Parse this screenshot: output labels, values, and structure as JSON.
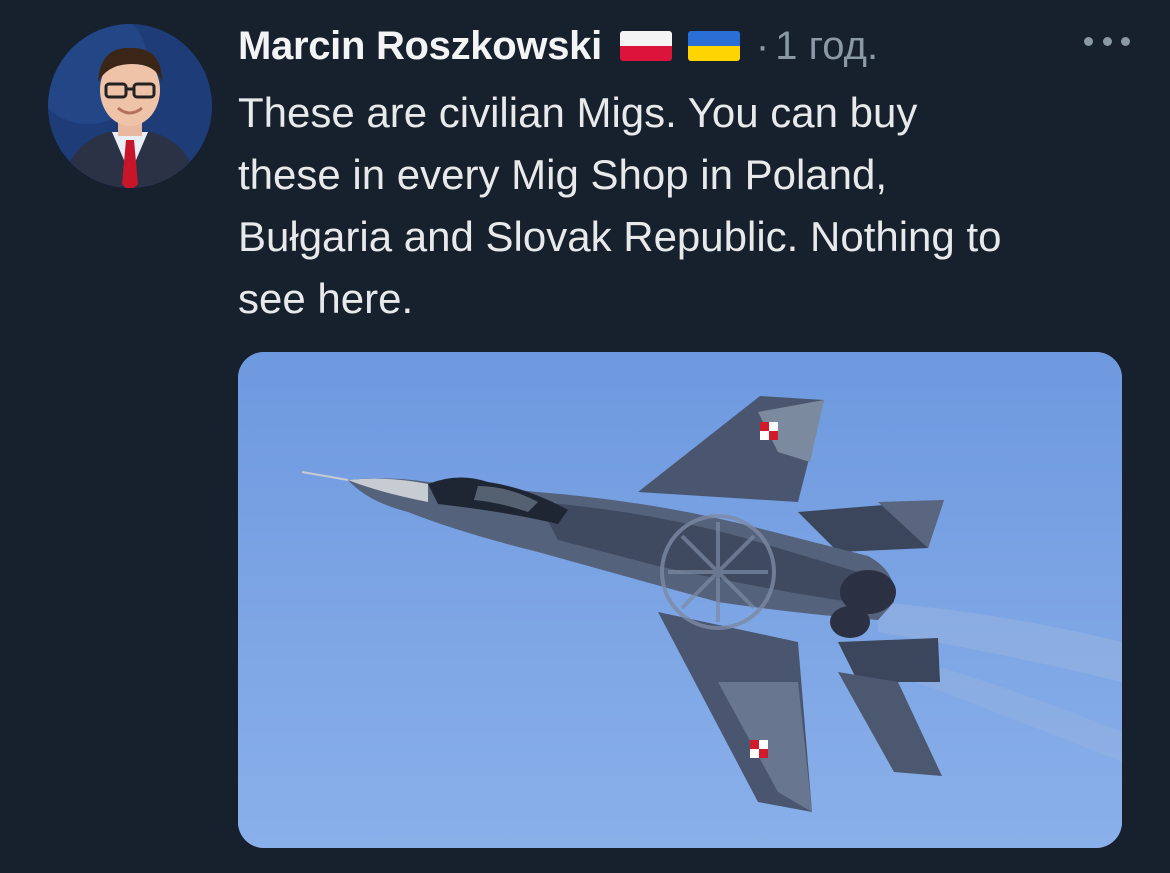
{
  "tweet": {
    "author": "Marcin Roszkowski",
    "flags": [
      "poland-flag-icon",
      "ukraine-flag-icon"
    ],
    "separator": "·",
    "time": "1 год.",
    "text": "These are civilian Migs. You can buy\nthese in every Mig Shop in Poland,\nBułgaria and Slovak Republic. Nothing to\nsee here.",
    "media_icon": "fighter-jet-photo"
  },
  "colors": {
    "background": "#17202d",
    "text": "#e7e9ea",
    "muted": "#8b98a5",
    "sky": "#79a3e6"
  }
}
